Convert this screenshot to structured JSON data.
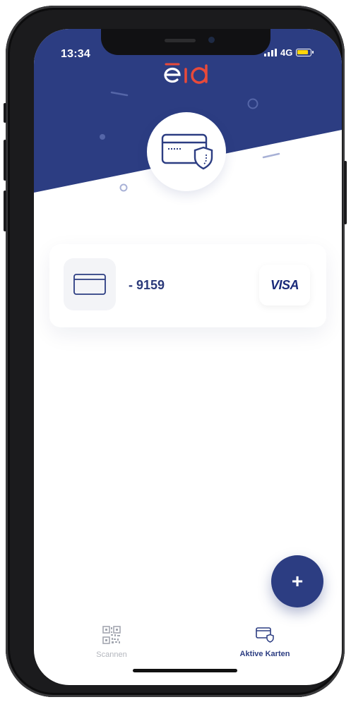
{
  "status_bar": {
    "time": "13:34",
    "network": "4G"
  },
  "app": {
    "logo_text": "eid"
  },
  "card": {
    "number": "- 9159",
    "brand": "VISA"
  },
  "fab": {
    "label": "+"
  },
  "tabs": [
    {
      "label": "Scannen",
      "icon": "qr-code-icon",
      "active": false
    },
    {
      "label": "Aktive Karten",
      "icon": "card-shield-icon",
      "active": true
    }
  ],
  "colors": {
    "primary": "#2c3d82",
    "logo_accent": "#e84a3a",
    "background": "#ffffff"
  }
}
